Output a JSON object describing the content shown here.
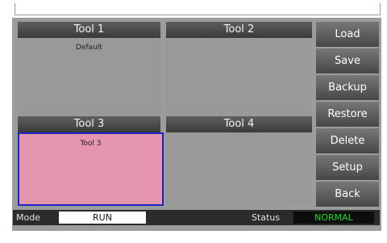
{
  "tools": [
    {
      "header": "Tool 1",
      "name": "Default",
      "selected": false
    },
    {
      "header": "Tool 2",
      "name": "",
      "selected": false
    },
    {
      "header": "Tool 3",
      "name": "Tool 3",
      "selected": true
    },
    {
      "header": "Tool 4",
      "name": "",
      "selected": false
    }
  ],
  "buttons": {
    "load": "Load",
    "save": "Save",
    "backup": "Backup",
    "restore": "Restore",
    "delete": "Delete",
    "setup": "Setup",
    "back": "Back"
  },
  "status_bar": {
    "mode_label": "Mode",
    "mode_value": "RUN",
    "status_label": "Status",
    "status_value": "NORMAL"
  },
  "colors": {
    "selected_fill": "#e596ae",
    "selected_border": "#1a24c8",
    "status_ok": "#18e018"
  }
}
